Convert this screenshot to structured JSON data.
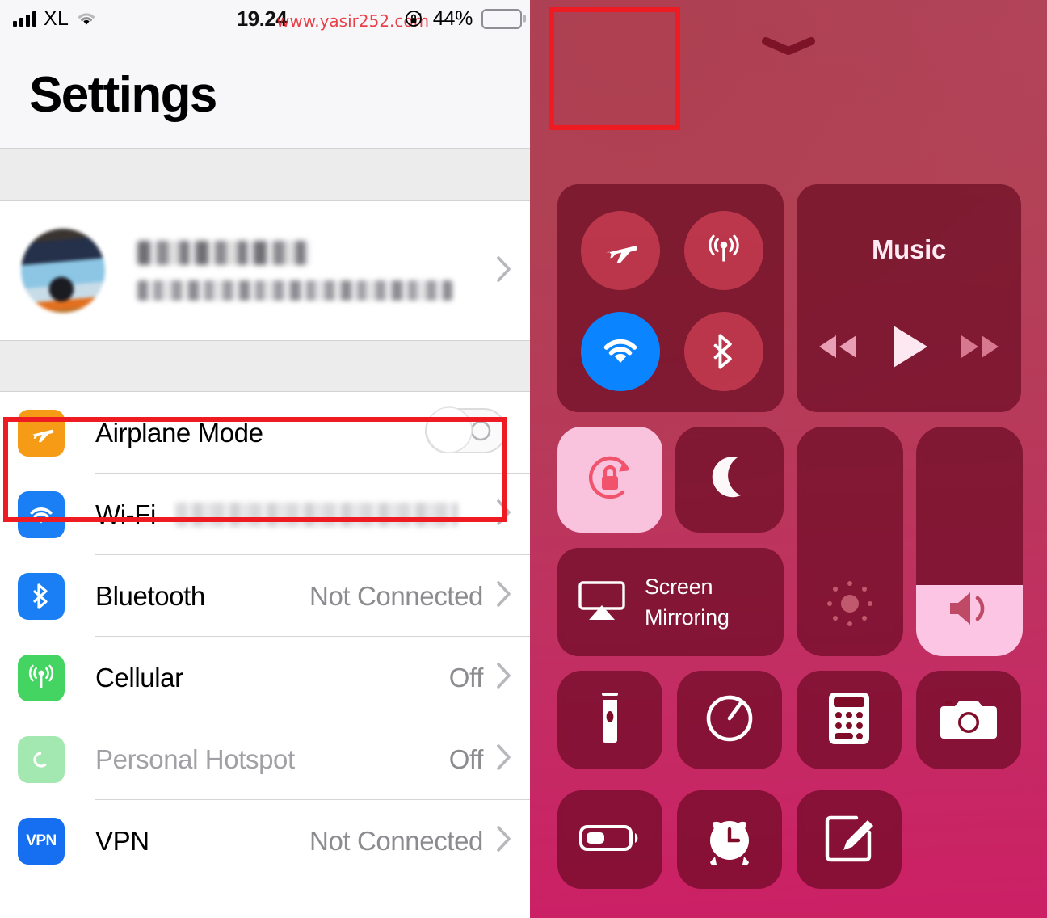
{
  "status_bar": {
    "signal_icon": "cellular-signal-icon",
    "carrier": "XL",
    "wifi_icon": "wifi-icon",
    "time": "19.24",
    "watermark": "www.yasir252.com",
    "rotation_lock_icon": "rotation-lock-icon",
    "battery_percent": "44%",
    "battery_level": 44,
    "battery_icon": "battery-icon"
  },
  "settings": {
    "title": "Settings",
    "account": {
      "name_redacted": "",
      "subtitle_redacted": "",
      "avatar_icon": "avatar"
    },
    "rows": [
      {
        "label": "Airplane Mode",
        "icon": "airplane-icon",
        "icon_color": "#f59b16",
        "control": "toggle",
        "toggle_on": false,
        "value": ""
      },
      {
        "label": "Wi-Fi",
        "icon": "wifi-icon",
        "icon_color": "#1a7ef4",
        "control": "chevron",
        "value_redacted": ""
      },
      {
        "label": "Bluetooth",
        "icon": "bluetooth-icon",
        "icon_color": "#1a7ef4",
        "control": "chevron",
        "value": "Not Connected"
      },
      {
        "label": "Cellular",
        "icon": "cellular-icon",
        "icon_color": "#44d461",
        "control": "chevron",
        "value": "Off"
      },
      {
        "label": "Personal Hotspot",
        "icon": "hotspot-icon",
        "icon_color": "#a4e8b1",
        "control": "chevron",
        "value": "Off",
        "disabled": true
      },
      {
        "label": "VPN",
        "icon": "vpn-icon",
        "icon_color": "#156ff0",
        "icon_text": "VPN",
        "control": "chevron",
        "value": "Not Connected"
      }
    ]
  },
  "control_center": {
    "handle_icon": "chevron-down-handle-icon",
    "connectivity": {
      "airplane": {
        "name": "airplane-mode-toggle",
        "icon": "airplane-icon",
        "active": false
      },
      "cellular": {
        "name": "cellular-data-toggle",
        "icon": "cellular-antenna-icon",
        "active": false
      },
      "wifi": {
        "name": "wifi-toggle",
        "icon": "wifi-icon",
        "active": true,
        "active_color": "#0a84ff"
      },
      "bluetooth": {
        "name": "bluetooth-toggle",
        "icon": "bluetooth-icon",
        "active": false
      }
    },
    "music": {
      "title": "Music",
      "rewind_icon": "rewind-icon",
      "play_icon": "play-icon",
      "forward_icon": "fast-forward-icon"
    },
    "rotation_lock": {
      "label": "rotation-lock-toggle",
      "icon": "rotation-lock-icon",
      "active": true
    },
    "do_not_disturb": {
      "label": "do-not-disturb-toggle",
      "icon": "moon-icon",
      "active": false
    },
    "screen_mirroring": {
      "label_line1": "Screen",
      "label_line2": "Mirroring",
      "icon": "airplay-screen-icon"
    },
    "brightness": {
      "name": "brightness-slider",
      "icon": "brightness-icon",
      "level": 0
    },
    "volume": {
      "name": "volume-slider",
      "icon": "speaker-icon",
      "level": 31
    },
    "shortcuts": [
      {
        "name": "flashlight-button",
        "icon": "flashlight-icon"
      },
      {
        "name": "timer-button",
        "icon": "timer-icon"
      },
      {
        "name": "calculator-button",
        "icon": "calculator-icon"
      },
      {
        "name": "camera-button",
        "icon": "camera-icon"
      },
      {
        "name": "low-power-mode-button",
        "icon": "battery-icon"
      },
      {
        "name": "alarm-button",
        "icon": "alarm-clock-icon"
      },
      {
        "name": "notes-button",
        "icon": "notes-pencil-icon"
      }
    ]
  },
  "annotations": {
    "highlight_color": "#ee1c22",
    "boxes": [
      {
        "name": "highlight-settings-airplane-row"
      },
      {
        "name": "highlight-cc-airplane-toggle"
      }
    ]
  }
}
